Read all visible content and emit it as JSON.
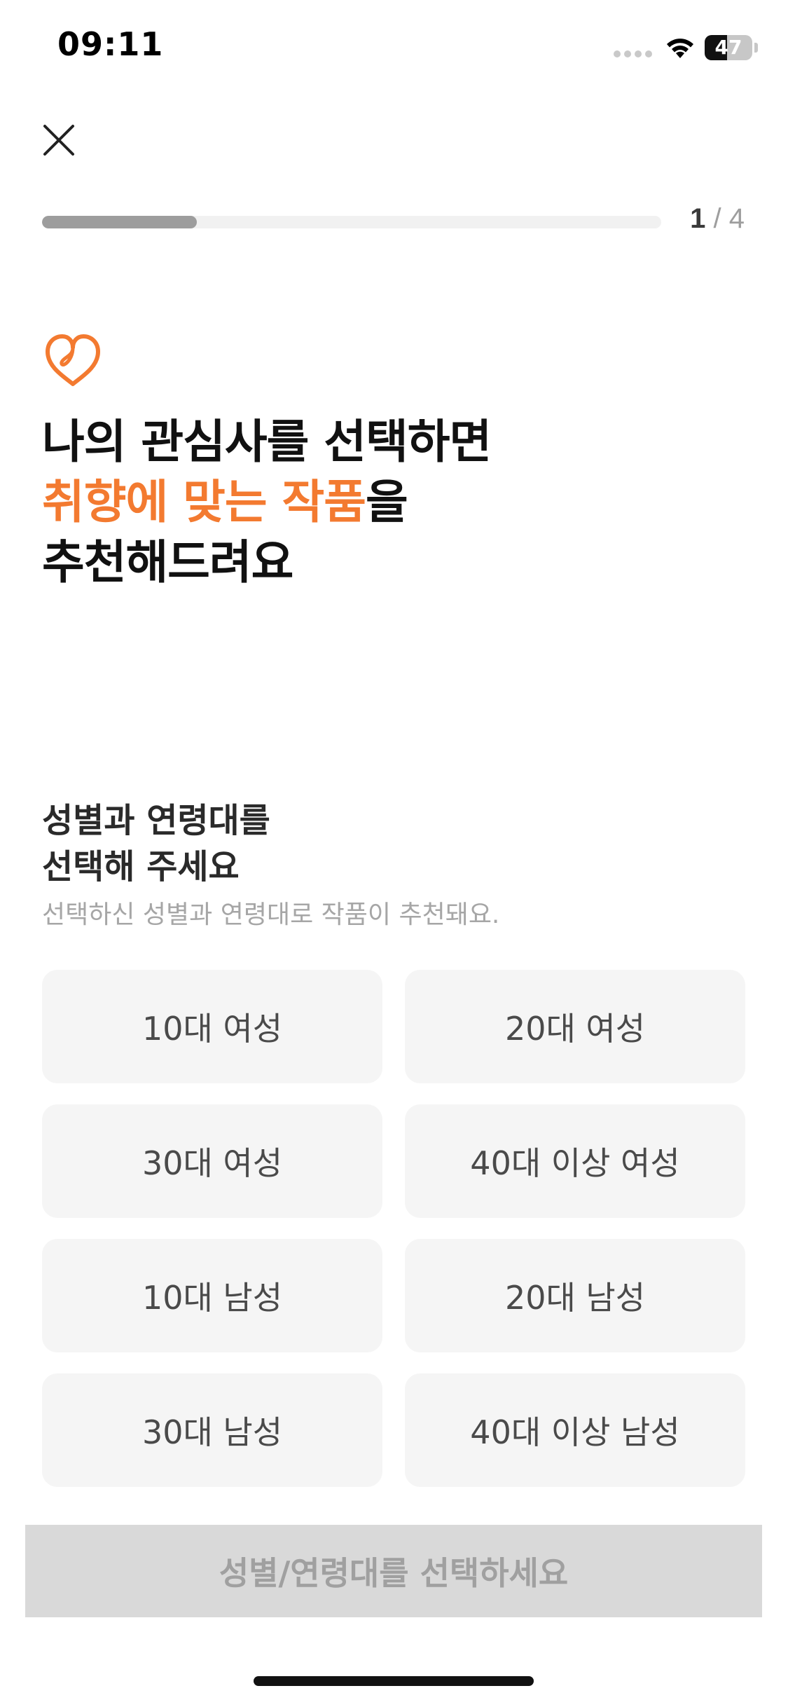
{
  "status_bar": {
    "time": "09:11",
    "battery_level": "47",
    "battery_fraction": 0.47
  },
  "progress": {
    "current": "1",
    "separator": " / ",
    "total": "4",
    "fraction": 0.25
  },
  "icons": {
    "close": "close-icon",
    "heart": "heart-icon",
    "accent_color": "#f37a30"
  },
  "headline": {
    "line1": "나의 관심사를 선택하면",
    "line2_accent": "취향에 맞는 작품",
    "line2_rest": "을",
    "line3": "추천해드려요"
  },
  "section": {
    "title_line1": "성별과 연령대를",
    "title_line2": "선택해 주세요",
    "subtitle": "선택하신 성별과 연령대로 작품이 추천돼요."
  },
  "options": [
    {
      "label": "10대 여성"
    },
    {
      "label": "20대 여성"
    },
    {
      "label": "30대 여성"
    },
    {
      "label": "40대 이상 여성"
    },
    {
      "label": "10대 남성"
    },
    {
      "label": "20대 남성"
    },
    {
      "label": "30대 남성"
    },
    {
      "label": "40대 이상 남성"
    }
  ],
  "submit": {
    "label": "성별/연령대를 선택하세요",
    "enabled": false
  }
}
